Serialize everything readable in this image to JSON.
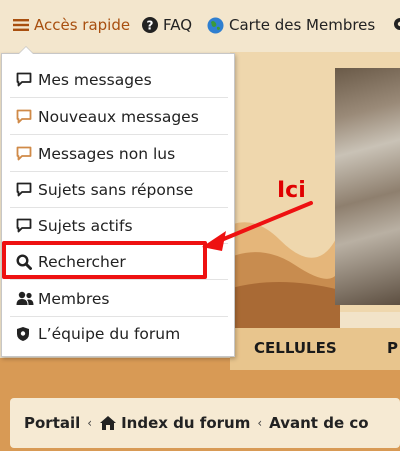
{
  "topbar": {
    "quick_access": "Accès rapide",
    "faq": "FAQ",
    "members_map": "Carte des Membres"
  },
  "menu": {
    "items": [
      {
        "label": "Mes messages",
        "icon": "speech-bubble-icon",
        "icon_color": "#222222"
      },
      {
        "label": "Nouveaux messages",
        "icon": "speech-bubble-icon",
        "icon_color": "#d08a48"
      },
      {
        "label": "Messages non lus",
        "icon": "speech-bubble-icon",
        "icon_color": "#d08a48"
      },
      {
        "label": "Sujets sans réponse",
        "icon": "speech-bubble-icon",
        "icon_color": "#222222"
      },
      {
        "label": "Sujets actifs",
        "icon": "speech-bubble-icon",
        "icon_color": "#222222"
      },
      {
        "label": "Rechercher",
        "icon": "search-icon",
        "icon_color": "#222222"
      },
      {
        "label": "Membres",
        "icon": "users-icon",
        "icon_color": "#222222"
      },
      {
        "label": "L’équipe du forum",
        "icon": "shield-icon",
        "icon_color": "#222222"
      }
    ]
  },
  "nav": {
    "cellules": "CELLULES",
    "next_partial": "P"
  },
  "breadcrumb": {
    "portal": "Portail",
    "index": "Index du forum",
    "current_partial": "Avant de co"
  },
  "annotation": {
    "label": "Ici",
    "color": "#ee1111"
  },
  "colors": {
    "accent": "#a84f0f",
    "background": "#f2e3c8",
    "band": "#d89a55"
  }
}
